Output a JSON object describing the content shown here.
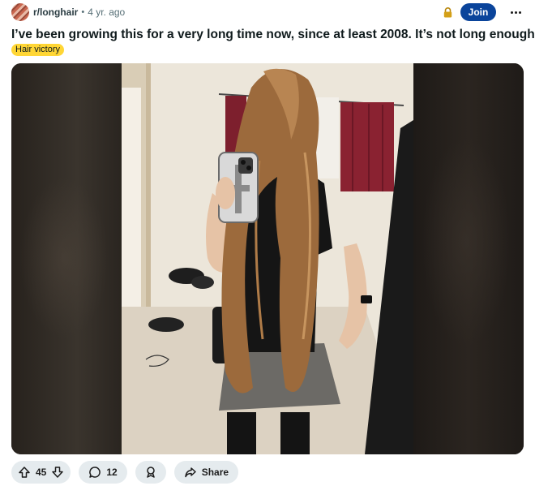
{
  "post": {
    "subreddit": "r/longhair",
    "separator": "•",
    "age": "4 yr. ago",
    "join_label": "Join",
    "title": "I’ve been growing this for a very long time now, since at least 2008. It’s not long enough.",
    "flair": "Hair victory"
  },
  "icons": {
    "lock": "lock-icon",
    "more": "more-options-icon",
    "upvote": "upvote-arrow-icon",
    "downvote": "downvote-arrow-icon",
    "comment": "comment-bubble-icon",
    "award": "award-icon",
    "share": "share-arrow-icon"
  },
  "actions": {
    "score": "45",
    "comments": "12",
    "share_label": "Share"
  },
  "colors": {
    "join": "#0a449b",
    "flair": "#ffd635",
    "pill": "#e5ebee",
    "lock": "#d4a017"
  }
}
